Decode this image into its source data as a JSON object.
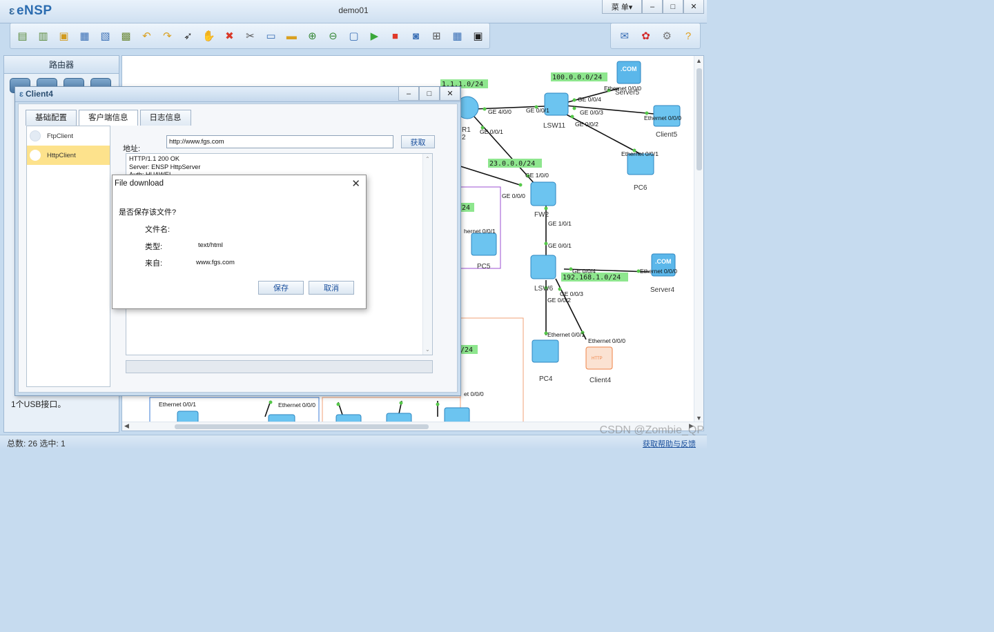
{
  "app": {
    "logo": "eNSP",
    "title": "demo01",
    "menu_label": "菜 单▾",
    "minimize": "–",
    "maximize": "□",
    "close": "✕"
  },
  "toolbar": {
    "icons": [
      "new-topology-icon",
      "new-file-icon",
      "open-icon",
      "save-icon",
      "save-as-icon",
      "print-icon",
      "undo-icon",
      "redo-icon",
      "select-pointer-icon",
      "hand-pan-icon",
      "delete-icon",
      "delete-link-icon",
      "text-note-icon",
      "rectangle-icon",
      "zoom-in-icon",
      "zoom-out-icon",
      "fit-view-icon",
      "start-device-icon",
      "stop-device-icon",
      "capture-icon",
      "topology-layout-icon",
      "grid-icon",
      "terminal-icon"
    ],
    "right_icons": [
      "chat-icon",
      "huawei-icon",
      "settings-icon",
      "help-icon"
    ]
  },
  "left_panel": {
    "title": "路由器",
    "desc_text": "1个USB接口。"
  },
  "topology": {
    "networks": [
      "1.1.1.0/24",
      "100.0.0.0/24",
      "23.0.0.0/24",
      "192.168.1.0/24",
      "24",
      "/24"
    ],
    "devices": [
      "Server5",
      "Client5",
      "LSW11",
      "PC6",
      "FW2",
      "PC5",
      "LSW6",
      "Server4",
      "PC4",
      "Client4"
    ],
    "device_fragments": [
      "R1",
      "2"
    ],
    "ports": [
      "Ethernet 0/0/0",
      "GE 0/0/4",
      "GE 4/0/0",
      "GE 0/0/1",
      "GE 0/0/3",
      "Ethernet 0/0/0",
      "GE 0/0/2",
      "GE 0/0/1",
      "Ethernet 0/0/1",
      "GE 1/0/0",
      "GE 0/0/0",
      "GE 1/0/1",
      "hernet 0/0/1",
      "GE 0/0/1",
      "GE 0/0/4",
      "Ethernet 0/0/0",
      "GE 0/0/3",
      "GE 0/0/2",
      "Ethernet 0/0/1",
      "Ethernet 0/0/0",
      "Ethernet 0/0/1",
      "Ethernet 0/0/0",
      "et 0/0/0"
    ]
  },
  "status": {
    "left": "总数: 26  选中: 1",
    "link": "获取帮助与反馈",
    "watermark": "CSDN @Zombie_QP"
  },
  "client_window": {
    "title": "Client4",
    "tabs": [
      "基础配置",
      "客户端信息",
      "日志信息"
    ],
    "clients": [
      "FtpClient",
      "HttpClient"
    ],
    "address_label": "地址:",
    "address_value": "http://www.fgs.com",
    "fetch_label": "获取",
    "response_lines": [
      "HTTP/1.1 200 OK",
      "Server: ENSP HttpServer",
      "Auth: HUAWEI"
    ]
  },
  "dialog": {
    "title": "File download",
    "question": "是否保存该文件?",
    "filename_label": "文件名:",
    "type_label": "类型:",
    "type_value": "text/html",
    "from_label": "来自:",
    "from_value": "www.fgs.com",
    "save_label": "保存",
    "cancel_label": "取消"
  },
  "colors": {
    "net_label_bg": "#8ee68e",
    "selected_item": "#fde28c",
    "link_line": "#111111",
    "port_dot": "#56c84a",
    "zone_purple": "#9b4fd1",
    "zone_orange": "#f2a277"
  }
}
